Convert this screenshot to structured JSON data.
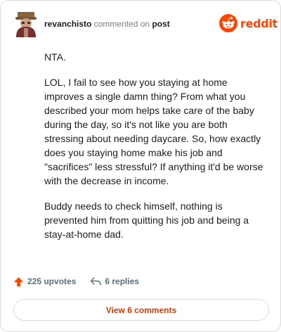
{
  "header": {
    "username": "revanchisto",
    "action_text": "commented on",
    "post_link": "post",
    "brand_word": "reddit",
    "brand_color": "#ff4500"
  },
  "comment": {
    "paragraphs": [
      "NTA.",
      "LOL, I fail to see how you staying at home improves a single damn thing? From what you described your mom helps take care of the baby during the day, so it's not like you are both stressing about needing daycare. So, how exactly does you staying home make his job and \"sacrifices\" less stressful? If anything it'd be worse with the decrease in income.",
      "Buddy needs to check himself, nothing is prevented him from quitting his job and being a stay-at-home dad."
    ]
  },
  "footer": {
    "upvotes_label": "225 upvotes",
    "replies_label": "6 replies",
    "upvote_icon": "upvote-arrow-icon",
    "reply_icon": "reply-arrow-icon",
    "upvote_color": "#ff4500"
  },
  "view_button": {
    "label": "View 6 comments",
    "color": "#d93a00"
  }
}
